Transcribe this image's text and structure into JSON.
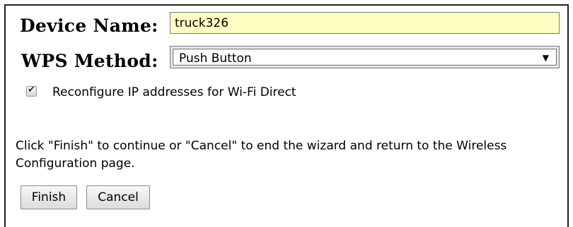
{
  "form": {
    "device_name_label": "Device Name:",
    "device_name_value": "truck326",
    "wps_method_label": "WPS Method:",
    "wps_method_selected": "Push Button",
    "dropdown_arrow": "▼",
    "reconfigure_checked": true,
    "reconfigure_label": "Reconfigure IP addresses for Wi-Fi Direct"
  },
  "instructions": "Click \"Finish\" to continue or \"Cancel\" to end the wizard and return to the Wireless Configuration page.",
  "buttons": {
    "finish_label": "Finish",
    "cancel_label": "Cancel"
  },
  "colors": {
    "device_name_field_bg": "#ffffc4"
  }
}
